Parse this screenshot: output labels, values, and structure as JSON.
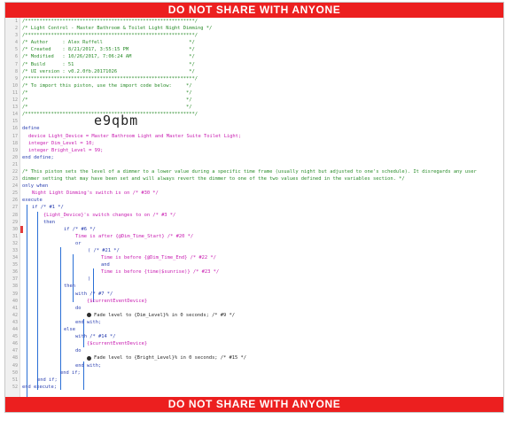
{
  "banner_top": "DO NOT SHARE WITH ANYONE",
  "banner_bottom": "DO NOT SHARE WITH ANYONE",
  "import_code": "e9qbm",
  "lines": [
    {
      "n": "1",
      "t": "/***********************************************************/"
    },
    {
      "n": "2",
      "t": "/* Light Control - Master Bathroom & Toilet Light Night Dimming */"
    },
    {
      "n": "3",
      "t": "/***********************************************************/"
    },
    {
      "n": "4",
      "t": "/* Author     : Alex Ruffell                              */"
    },
    {
      "n": "5",
      "t": "/* Created    : 8/21/2017, 3:55:15 PM                     */"
    },
    {
      "n": "6",
      "t": "/* Modified   : 10/26/2017, 7:06:24 AM                    */"
    },
    {
      "n": "7",
      "t": "/* Build      : 51                                        */"
    },
    {
      "n": "8",
      "t": "/* UI version : v0.2.0fb.20171026                         */"
    },
    {
      "n": "9",
      "t": "/***********************************************************/"
    },
    {
      "n": "10",
      "t": "/* To import this piston, use the import code below:     */"
    },
    {
      "n": "11",
      "t": "/*                                                       */"
    },
    {
      "n": "12",
      "t": "/*                                                       */"
    },
    {
      "n": "13",
      "t": "/*                                                       */"
    },
    {
      "n": "14",
      "t": "/***********************************************************/"
    },
    {
      "n": "15",
      "t": ""
    },
    {
      "n": "16",
      "t": "define"
    },
    {
      "n": "17",
      "t": "device Light_Device = Master Bathroom Light and Master Suite Toilet Light;"
    },
    {
      "n": "18",
      "t": "integer Dim_Level = 10;"
    },
    {
      "n": "19",
      "t": "integer Bright_Level = 99;"
    },
    {
      "n": "20",
      "t": "end define;"
    },
    {
      "n": "21",
      "t": ""
    },
    {
      "n": "22",
      "t": "/* This piston sets the level of a dimmer to a lower value during a specific time frame (usually night but adjusted to one's schedule). It disregards any user"
    },
    {
      "n": "23",
      "t": "dimmer setting that may have been set and will always revert the dimmer to one of the two values defined in the variables section. */"
    },
    {
      "n": "24",
      "t": "only when"
    },
    {
      "n": "25",
      "t": "Night Light Dimming's switch is on /* #30 */"
    },
    {
      "n": "26",
      "t": "execute"
    },
    {
      "n": "27",
      "t": "if /* #1 */"
    },
    {
      "n": "28",
      "t": "{Light_Device}'s switch changes to on /* #3 */"
    },
    {
      "n": "29",
      "t": "then"
    },
    {
      "n": "30",
      "t": "if /* #6 */"
    },
    {
      "n": "31",
      "t": "Time is after {@Dim_Time_Start} /* #20 */"
    },
    {
      "n": "32",
      "t": "or"
    },
    {
      "n": "33",
      "t": "( /* #21 */"
    },
    {
      "n": "34",
      "t": "Time is before {@Dim_Time_End} /* #22 */"
    },
    {
      "n": "35",
      "t": "and"
    },
    {
      "n": "36",
      "t": "Time is before {time($sunrise)} /* #23 */"
    },
    {
      "n": "37",
      "t": ")"
    },
    {
      "n": "38",
      "t": "then"
    },
    {
      "n": "39",
      "t": "with /* #7 */"
    },
    {
      "n": "40",
      "t": "{$currentEventDevice}"
    },
    {
      "n": "41",
      "t": "do"
    },
    {
      "n": "42",
      "t": "Fade level to {Dim_Level}% in 0 seconds; /* #9 */"
    },
    {
      "n": "43",
      "t": "end with;"
    },
    {
      "n": "44",
      "t": "else"
    },
    {
      "n": "45",
      "t": "with /* #14 */"
    },
    {
      "n": "46",
      "t": "{$currentEventDevice}"
    },
    {
      "n": "47",
      "t": "do"
    },
    {
      "n": "48",
      "t": "Fade level to {Bright_Level}% in 0 seconds; /* #15 */"
    },
    {
      "n": "49",
      "t": "end with;"
    },
    {
      "n": "50",
      "t": "end if;"
    },
    {
      "n": "51",
      "t": "end if;"
    },
    {
      "n": "52",
      "t": "end execute;"
    }
  ]
}
